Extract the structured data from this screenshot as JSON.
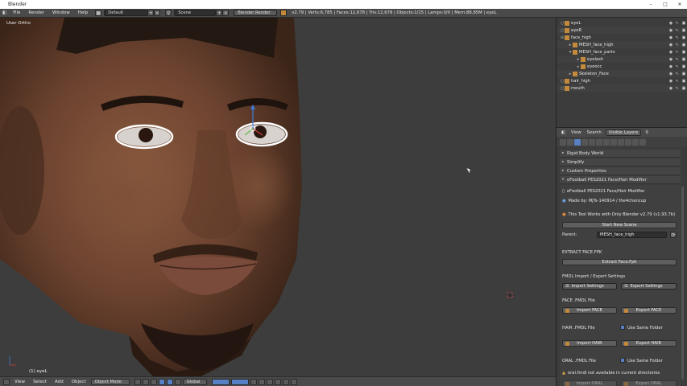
{
  "window": {
    "title": "Blender"
  },
  "topbar": {
    "menus": [
      "File",
      "Render",
      "Window",
      "Help"
    ],
    "layout": "Default",
    "scene": "Scene",
    "engine": "Blender Render",
    "stats": "v2.79 | Verts:6,785 | Faces:12,678 | Tris:12,678 | Objects:1/15 | Lamps:0/0 | Mem:88.85M | eyeL"
  },
  "viewport": {
    "view_label": "User Ortho",
    "object_label": "(1) eyeL",
    "header": {
      "menus": [
        "View",
        "Select",
        "Add",
        "Object"
      ],
      "mode": "Object Mode",
      "orientation": "Global"
    }
  },
  "outliner": {
    "rows": [
      {
        "name": "eyeL",
        "indent": 0
      },
      {
        "name": "eyeR",
        "indent": 0
      },
      {
        "name": "face_high",
        "indent": 0
      },
      {
        "name": "MESH_face_high",
        "indent": 1
      },
      {
        "name": "MESH_face_parts",
        "indent": 1
      },
      {
        "name": "eyelash",
        "indent": 2
      },
      {
        "name": "eyeocc",
        "indent": 2
      },
      {
        "name": "Skeleton_Face",
        "indent": 1
      },
      {
        "name": "hair_high",
        "indent": 0
      },
      {
        "name": "mouth",
        "indent": 0
      }
    ]
  },
  "properties": {
    "header": {
      "view": "View",
      "search": "Search",
      "filter": "Visible Layers"
    },
    "panels": {
      "rigid": "Rigid Body World",
      "simplify": "Simplify",
      "custom": "Custom Properties",
      "addon": "eFootball PES2021 Face/Hair Modifier"
    },
    "addon": {
      "name_line": "eFootball PES2021 Face/Hair Modifier",
      "made_by": "Made by: MjTs-140914 / the4chancup",
      "works_with": "This Tool Works with Only Blender v2.79 (v1.93.7b)",
      "start_new_scene": "Start New Scene",
      "parent_label": "Parent:",
      "parent_value": "MESH_face_high",
      "extract_title": "EXTRACT FACE.FPK",
      "extract_btn": "Extract Face.Fpk",
      "fmdl_title": "FMDL Import / Export Settings",
      "import_settings": "Import Settings",
      "export_settings": "Export Settings",
      "face_title": "FACE .FMDL File",
      "import_face": "Import FACE",
      "export_face": "Export FACE",
      "hair_title": "HAIR .FMDL File",
      "use_same_folder": "Use Same Folder",
      "import_hair": "Import HAIR",
      "export_hair": "Export HAIR",
      "oral_title": "ORAL .FMDL File",
      "oral_warning": "oral.fmdl not available in current directories",
      "import_oral": "Import ORAL",
      "export_oral": "Export ORAL"
    }
  }
}
